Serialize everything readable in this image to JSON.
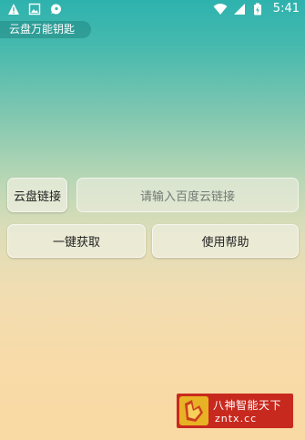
{
  "status_bar": {
    "time": "5:41",
    "left_icons": [
      "warning-icon",
      "image-icon",
      "chat-bubble-icon"
    ],
    "right_icons": [
      "wifi-icon",
      "signal-icon",
      "battery-charging-icon"
    ]
  },
  "app": {
    "title": "云盘万能钥匙"
  },
  "form": {
    "link_label": "云盘链接",
    "link_placeholder": "请输入百度云链接",
    "get_button": "一键获取",
    "help_button": "使用帮助"
  },
  "watermark": {
    "title": "八神智能天下",
    "url": "zntx.cc"
  },
  "colors": {
    "gradient_top": "#2eb2ae",
    "gradient_bottom": "#fadaa3",
    "watermark_red": "#c8291e",
    "watermark_gold": "#e8b225"
  }
}
